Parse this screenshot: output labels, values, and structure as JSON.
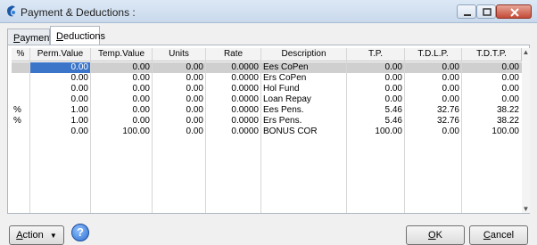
{
  "window": {
    "title": "Payment & Deductions :"
  },
  "tabs": [
    {
      "label_ul": "P",
      "label_rest": "ayments"
    },
    {
      "label_ul": "D",
      "label_rest": "eductions"
    }
  ],
  "table": {
    "columns": [
      "%",
      "Perm.Value",
      "Temp.Value",
      "Units",
      "Rate",
      "Description",
      "T.P.",
      "T.D.L.P.",
      "T.D.T.P."
    ],
    "rows": [
      [
        "",
        "0.00",
        "0.00",
        "0.00",
        "0.0000",
        "Ees CoPen",
        "0.00",
        "0.00",
        "0.00"
      ],
      [
        "",
        "0.00",
        "0.00",
        "0.00",
        "0.0000",
        "Ers CoPen",
        "0.00",
        "0.00",
        "0.00"
      ],
      [
        "",
        "0.00",
        "0.00",
        "0.00",
        "0.0000",
        "Hol Fund",
        "0.00",
        "0.00",
        "0.00"
      ],
      [
        "",
        "0.00",
        "0.00",
        "0.00",
        "0.0000",
        "Loan Repay",
        "0.00",
        "0.00",
        "0.00"
      ],
      [
        "%",
        "1.00",
        "0.00",
        "0.00",
        "0.0000",
        "Ees Pens.",
        "5.46",
        "32.76",
        "38.22"
      ],
      [
        "%",
        "1.00",
        "0.00",
        "0.00",
        "0.0000",
        "Ers Pens.",
        "5.46",
        "32.76",
        "38.22"
      ],
      [
        "",
        "0.00",
        "100.00",
        "0.00",
        "0.0000",
        "BONUS COR",
        "100.00",
        "0.00",
        "100.00"
      ]
    ]
  },
  "buttons": {
    "action_ul": "A",
    "action_rest": "ction",
    "help": "?",
    "ok_ul": "O",
    "ok_rest": "K",
    "cancel_ul": "C",
    "cancel_rest": "ancel"
  },
  "colors": {
    "selection": "#3b75c9",
    "selected_row": "#cfcfcf",
    "title_bar": "#dce8f5"
  }
}
